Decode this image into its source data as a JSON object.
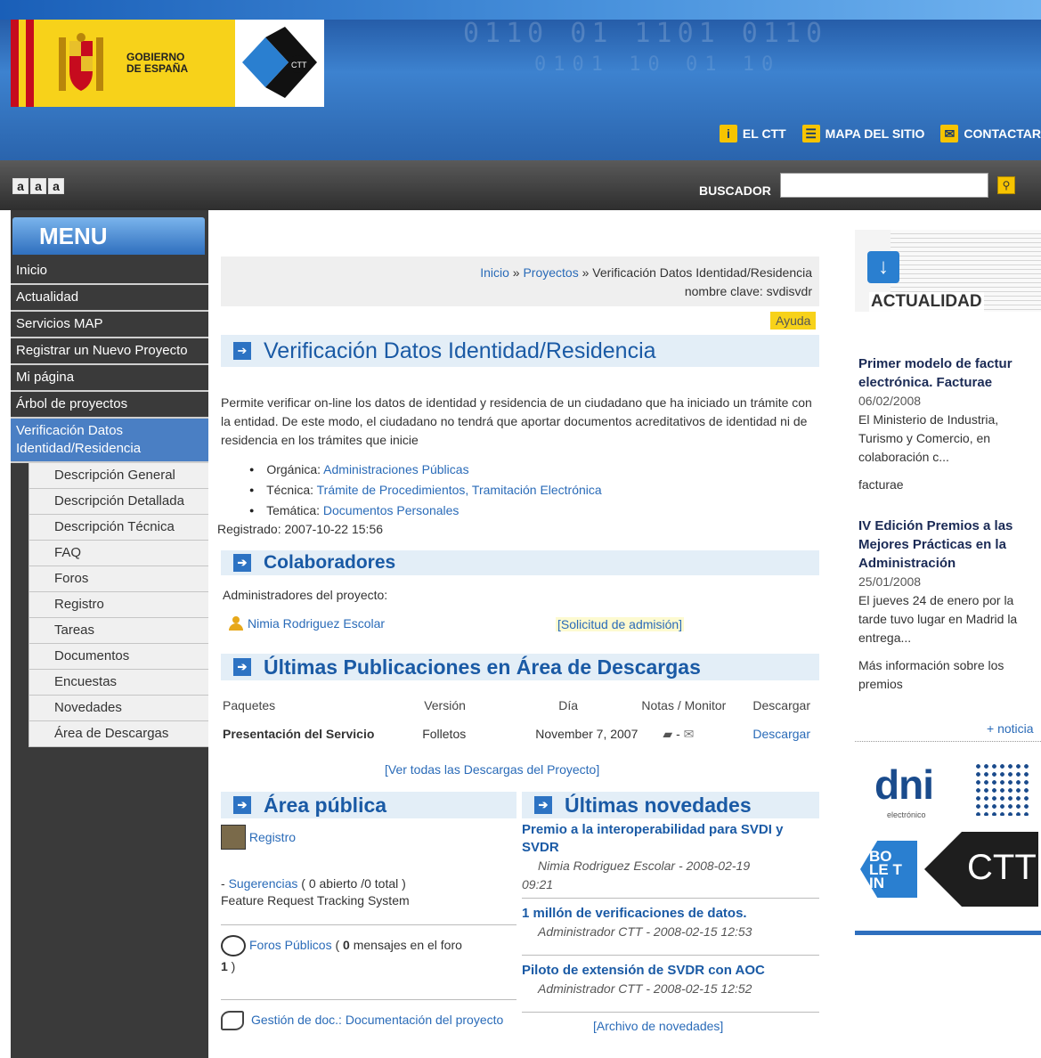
{
  "header": {
    "gov_line1": "GOBIERNO",
    "gov_line2": "DE ESPAÑA",
    "ctt_logo_text": "CTT",
    "topnav": [
      {
        "label": "EL CTT",
        "icon": "info-icon"
      },
      {
        "label": "MAPA DEL SITIO",
        "icon": "sitemap-icon"
      },
      {
        "label": "CONTACTAR",
        "icon": "envelope-icon"
      }
    ]
  },
  "toolbar": {
    "font_sizes": [
      "a",
      "a",
      "a"
    ],
    "search_label": "BUSCADOR",
    "search_value": ""
  },
  "menu": {
    "title": "MENU",
    "items": [
      "Inicio",
      "Actualidad",
      "Servicios MAP",
      "Registrar un Nuevo Proyecto",
      "Mi página",
      "Árbol de proyectos",
      "Verificación Datos Identidad/Residencia"
    ],
    "subitems": [
      "Descripción General",
      "Descripción Detallada",
      "Descripción Técnica",
      "FAQ",
      "Foros",
      "Registro",
      "Tareas",
      "Documentos",
      "Encuestas",
      "Novedades",
      "Área de Descargas"
    ]
  },
  "breadcrumb": {
    "home": "Inicio",
    "sep": "»",
    "projects": "Proyectos",
    "current": "Verificación Datos Identidad/Residencia",
    "codename": "nombre clave: svdisvdr"
  },
  "help_label": "Ayuda",
  "project": {
    "title": "Verificación Datos Identidad/Residencia",
    "description": "Permite verificar on-line los datos de identidad y residencia de un ciudadano que ha iniciado un trámite con la entidad. De este modo, el ciudadano no tendrá que aportar documentos acreditativos de identidad ni de residencia en los trámites que inicie",
    "categories": [
      {
        "label": "Orgánica:",
        "value": "Administraciones Públicas"
      },
      {
        "label": "Técnica:",
        "value": "Trámite de Procedimientos, Tramitación Electrónica"
      },
      {
        "label": "Temática:",
        "value": "Documentos Personales"
      }
    ],
    "registered": "Registrado: 2007-10-22 15:56"
  },
  "collaborators": {
    "title": "Colaboradores",
    "admins_label": "Administradores del proyecto:",
    "admin_name": "Nimia Rodriguez Escolar",
    "admission_link": "[Solicitud de admisión]"
  },
  "downloads": {
    "title": "Últimas Publicaciones en Área de Descargas",
    "headers": [
      "Paquetes",
      "Versión",
      "Día",
      "Notas / Monitor",
      "Descargar"
    ],
    "rows": [
      {
        "package": "Presentación del Servicio",
        "version": "Folletos",
        "date": "November 7, 2007",
        "notes": "- ",
        "download": "Descargar"
      }
    ],
    "view_all": "[Ver todas las Descargas del Proyecto]"
  },
  "public_area": {
    "title": "Área pública",
    "registro": "Registro",
    "suggest_prefix": " - ",
    "suggest_link": "Sugerencias",
    "suggest_counts": " ( 0 abierto /0 total )",
    "suggest_desc": "Feature Request Tracking System",
    "forums_link": "Foros Públicos",
    "forums_open": " ( ",
    "forums_count": "0",
    "forums_text": " mensajes en el foro ",
    "forums_count2": "1",
    "forums_close": " )",
    "docs_link": "Gestión de doc.: Documentación del proyecto"
  },
  "news": {
    "title": "Últimas novedades",
    "items": [
      {
        "title": "Premio a la interoperabilidad para SVDI y SVDR",
        "meta": "Nimia Rodriguez Escolar - 2008-02-19",
        "meta2": "09:21"
      },
      {
        "title": "1 millón de verificaciones de datos.",
        "meta": "Administrador CTT - 2008-02-15 12:53"
      },
      {
        "title": "Piloto de extensión de SVDR con AOC",
        "meta": "Administrador CTT - 2008-02-15 12:52"
      }
    ],
    "archive": "[Archivo de novedades]"
  },
  "sidebar_right": {
    "banner_label": "ACTUALIDAD",
    "items": [
      {
        "title": "Primer modelo de factur electrónica. Facturae",
        "date": "06/02/2008",
        "text": "El Ministerio de Industria, Turismo y Comercio, en colaboración c...",
        "tag": "facturae"
      },
      {
        "title": "IV Edición Premios a las Mejores Prácticas en la Administración",
        "date": "25/01/2008",
        "text": "El jueves 24 de enero por la tarde tuvo lugar en Madrid la entrega...",
        "link": "Más información sobre los premios"
      }
    ],
    "more": "+ noticia",
    "dni_text": "dni",
    "dni_sub": "electrónico",
    "boletin_text": "BO LE TIN",
    "boletin_ctt": "CTT"
  },
  "colors": {
    "accent": "#2d73c3",
    "menu_bg": "#3a3a3a",
    "menu_active": "#4a7fc4",
    "help_bg": "#f7d21a"
  }
}
